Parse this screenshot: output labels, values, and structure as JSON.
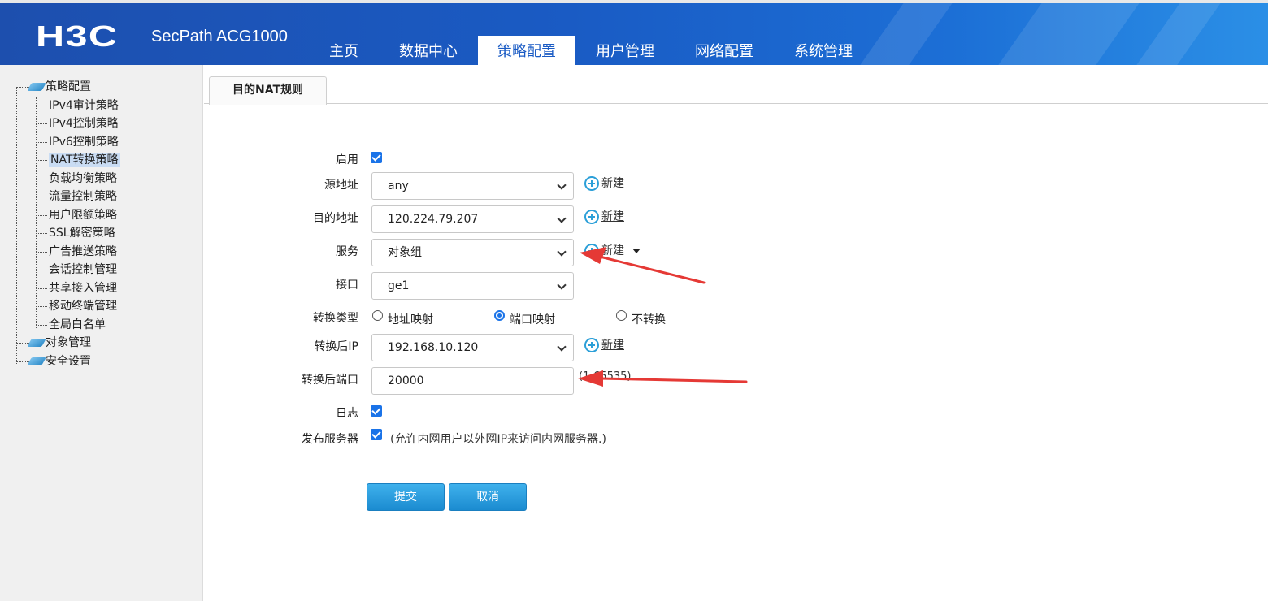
{
  "header": {
    "logo": "H3C",
    "product": "SecPath ACG1000",
    "tabs": [
      "主页",
      "数据中心",
      "策略配置",
      "用户管理",
      "网络配置",
      "系统管理"
    ],
    "active_tab": "策略配置"
  },
  "sidebar": {
    "root": "策略配置",
    "items": [
      "IPv4审计策略",
      "IPv4控制策略",
      "IPv6控制策略",
      "NAT转换策略",
      "负载均衡策略",
      "流量控制策略",
      "用户限额策略",
      "SSL解密策略",
      "广告推送策略",
      "会话控制管理",
      "共享接入管理",
      "移动终端管理",
      "全局白名单"
    ],
    "selected": "NAT转换策略",
    "other_roots": [
      "对象管理",
      "安全设置"
    ]
  },
  "content": {
    "tab": "目的NAT规则",
    "form": {
      "enable_label": "启用",
      "source_label": "源地址",
      "source_value": "any",
      "dest_label": "目的地址",
      "dest_value": "120.224.79.207",
      "service_label": "服务",
      "service_value": "对象组",
      "interface_label": "接口",
      "interface_value": "ge1",
      "type_label": "转换类型",
      "type_options": [
        "地址映射",
        "端口映射",
        "不转换"
      ],
      "type_selected": "端口映射",
      "trans_ip_label": "转换后IP",
      "trans_ip_value": "192.168.10.120",
      "trans_port_label": "转换后端口",
      "trans_port_value": "20000",
      "trans_port_hint": "(1-65535)",
      "log_label": "日志",
      "publish_label": "发布服务器",
      "publish_hint": "(允许内网用户以外网IP来访问内网服务器.)",
      "new_label": "新建",
      "submit": "提交",
      "cancel": "取消"
    }
  },
  "colors": {
    "header_blue": "#1a5bc4",
    "accent": "#1a73e8",
    "button": "#2b9fd8",
    "arrow": "#e53935"
  }
}
